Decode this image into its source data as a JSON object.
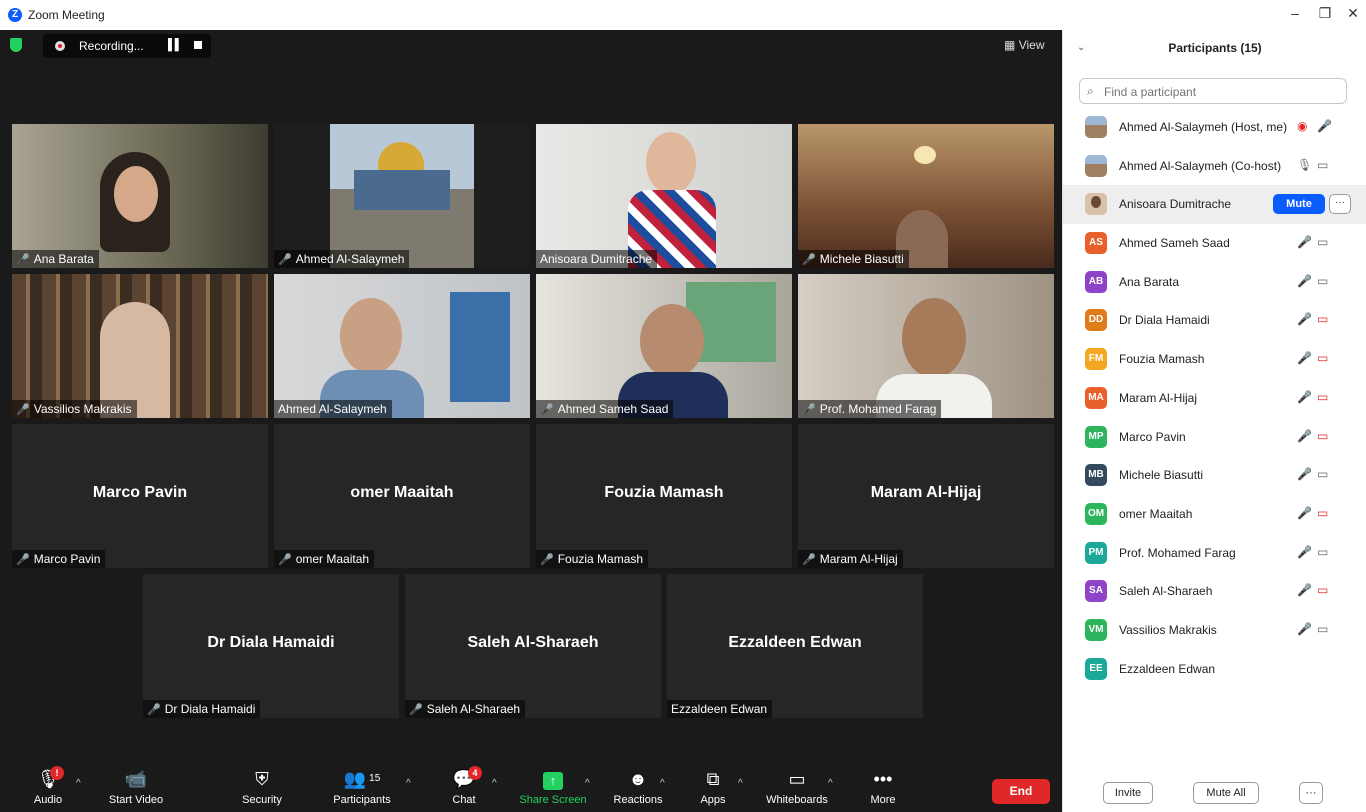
{
  "window": {
    "title": "Zoom Meeting"
  },
  "topbar": {
    "recording_label": "Recording...",
    "view_label": "View"
  },
  "tiles": [
    {
      "name": "Ana Barata",
      "muted": true,
      "video": true
    },
    {
      "name": "Ahmed Al-Salaymeh",
      "muted": true,
      "video": true
    },
    {
      "name": "Anisoara Dumitrache",
      "muted": false,
      "video": true
    },
    {
      "name": "Michele Biasutti",
      "muted": true,
      "video": true
    },
    {
      "name": "Vassilios Makrakis",
      "muted": true,
      "video": true
    },
    {
      "name": "Ahmed Al-Salaymeh",
      "muted": false,
      "video": true,
      "active_speaker": true
    },
    {
      "name": "Ahmed Sameh Saad",
      "muted": true,
      "video": true
    },
    {
      "name": "Prof. Mohamed Farag",
      "muted": true,
      "video": true
    },
    {
      "name": "Marco Pavin",
      "muted": true,
      "video": false
    },
    {
      "name": "omer Maaitah",
      "muted": true,
      "video": false
    },
    {
      "name": "Fouzia Mamash",
      "muted": true,
      "video": false
    },
    {
      "name": "Maram Al-Hijaj",
      "muted": true,
      "video": false
    },
    {
      "name": "Dr Diala Hamaidi",
      "muted": true,
      "video": false
    },
    {
      "name": "Saleh Al-Sharaeh",
      "muted": true,
      "video": false
    },
    {
      "name": "Ezzaldeen Edwan",
      "muted": false,
      "video": false
    }
  ],
  "toolbar": {
    "audio": "Audio",
    "start_video": "Start Video",
    "security": "Security",
    "participants": "Participants",
    "participants_count": "15",
    "chat": "Chat",
    "chat_badge": "4",
    "audio_badge": "!",
    "share_screen": "Share Screen",
    "reactions": "Reactions",
    "apps": "Apps",
    "whiteboards": "Whiteboards",
    "more": "More",
    "end": "End"
  },
  "panel": {
    "title": "Participants (15)",
    "search_placeholder": "Find a participant",
    "participants": [
      {
        "name": "Ahmed Al-Salaymeh (Host, me)",
        "avatar": "photo",
        "color": ""
      },
      {
        "name": "Ahmed Al-Salaymeh (Co-host)",
        "avatar": "photo",
        "color": ""
      },
      {
        "name": "Anisoara Dumitrache",
        "avatar": "face",
        "color": ""
      },
      {
        "name": "Ahmed Sameh Saad",
        "initials": "AS",
        "color": "#e8612c"
      },
      {
        "name": "Ana Barata",
        "initials": "AB",
        "color": "#8e44c9"
      },
      {
        "name": "Dr Diala Hamaidi",
        "initials": "DD",
        "color": "#e07b1a"
      },
      {
        "name": "Fouzia Mamash",
        "initials": "FM",
        "color": "#f5a623"
      },
      {
        "name": "Maram Al-Hijaj",
        "initials": "MA",
        "color": "#e8612c"
      },
      {
        "name": "Marco Pavin",
        "initials": "MP",
        "color": "#2db55d"
      },
      {
        "name": "Michele Biasutti",
        "initials": "MB",
        "color": "#34495e"
      },
      {
        "name": "omer Maaitah",
        "initials": "OM",
        "color": "#2db55d"
      },
      {
        "name": "Prof. Mohamed Farag",
        "initials": "PM",
        "color": "#1aa898"
      },
      {
        "name": "Saleh Al-Sharaeh",
        "initials": "SA",
        "color": "#8e44c9"
      },
      {
        "name": "Vassilios Makrakis",
        "initials": "VM",
        "color": "#2db55d"
      },
      {
        "name": "Ezzaldeen Edwan",
        "initials": "EE",
        "color": "#1aa898"
      }
    ],
    "mute_label": "Mute",
    "more_label": "···",
    "invite_label": "Invite",
    "mute_all_label": "Mute All",
    "footer_more_label": "···"
  }
}
